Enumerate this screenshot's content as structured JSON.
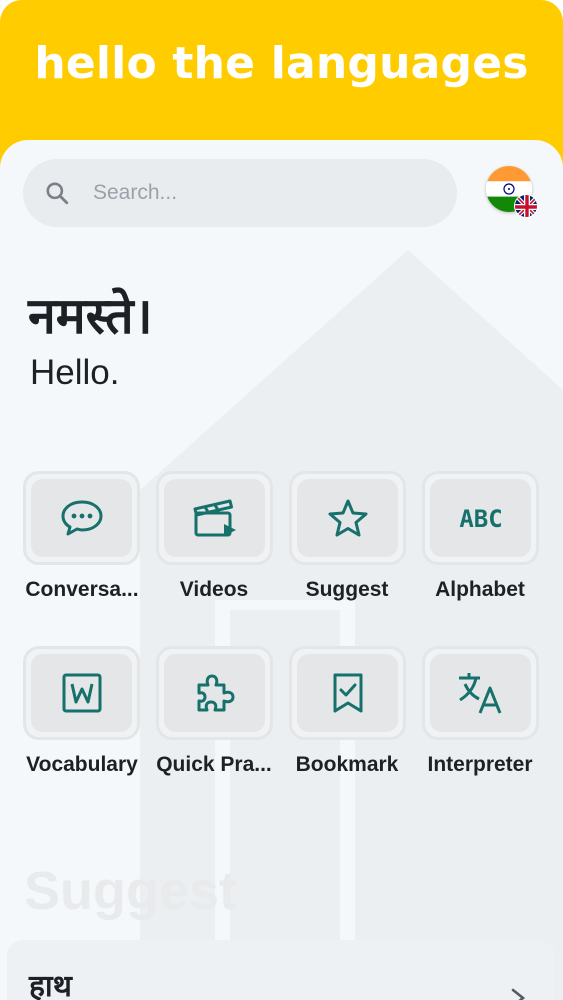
{
  "app": {
    "title": "hello the languages"
  },
  "search": {
    "placeholder": "Search..."
  },
  "language": {
    "native_flag": "india-flag-icon",
    "target_flag": "uk-flag-icon"
  },
  "greeting": {
    "native": "नमस्ते।",
    "translation": "Hello."
  },
  "menu": [
    {
      "label": "Conversa...",
      "icon": "chat-bubble-icon"
    },
    {
      "label": "Videos",
      "icon": "clapperboard-icon"
    },
    {
      "label": "Suggest",
      "icon": "star-icon"
    },
    {
      "label": "Alphabet",
      "icon": "abc-icon"
    },
    {
      "label": "Vocabulary",
      "icon": "word-document-icon"
    },
    {
      "label": "Quick Pra...",
      "icon": "puzzle-icon"
    },
    {
      "label": "Bookmark",
      "icon": "bookmark-check-icon"
    },
    {
      "label": "Interpreter",
      "icon": "translate-icon"
    }
  ],
  "suggest": {
    "heading": "Suggest",
    "items": [
      {
        "word": "हाथ"
      }
    ]
  },
  "colors": {
    "accent": "#ffcc00",
    "icon": "#16706b",
    "text": "#1d2125",
    "sheet": "#f5f8fa"
  }
}
